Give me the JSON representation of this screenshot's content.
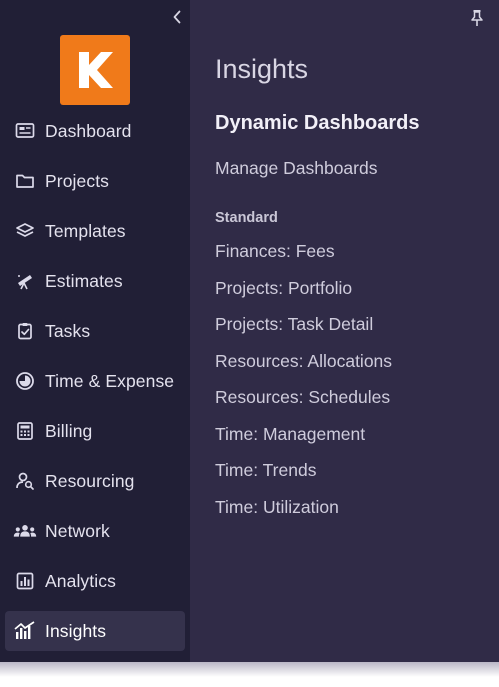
{
  "sidebar": {
    "collapse_icon": "chevron-left-icon",
    "logo_icon": "k-logo-icon",
    "brand_color": "#f07a1a",
    "items": [
      {
        "label": "Dashboard",
        "icon": "dashboard-icon"
      },
      {
        "label": "Projects",
        "icon": "folder-icon"
      },
      {
        "label": "Templates",
        "icon": "layers-icon"
      },
      {
        "label": "Estimates",
        "icon": "telescope-icon"
      },
      {
        "label": "Tasks",
        "icon": "clipboard-check-icon"
      },
      {
        "label": "Time & Expense",
        "icon": "clock-pie-icon"
      },
      {
        "label": "Billing",
        "icon": "calculator-icon"
      },
      {
        "label": "Resourcing",
        "icon": "user-search-icon"
      },
      {
        "label": "Network",
        "icon": "users-icon"
      },
      {
        "label": "Analytics",
        "icon": "bar-chart-icon"
      },
      {
        "label": "Insights",
        "icon": "insights-chart-icon",
        "active": true
      }
    ]
  },
  "panel": {
    "pin_icon": "pin-icon",
    "title": "Insights",
    "section_title": "Dynamic Dashboards",
    "manage_link": "Manage Dashboards",
    "group_label": "Standard",
    "dashboards": [
      "Finances: Fees",
      "Projects: Portfolio",
      "Projects: Task Detail",
      "Resources: Allocations",
      "Resources: Schedules",
      "Time: Management",
      "Time: Trends",
      "Time: Utilization"
    ]
  }
}
